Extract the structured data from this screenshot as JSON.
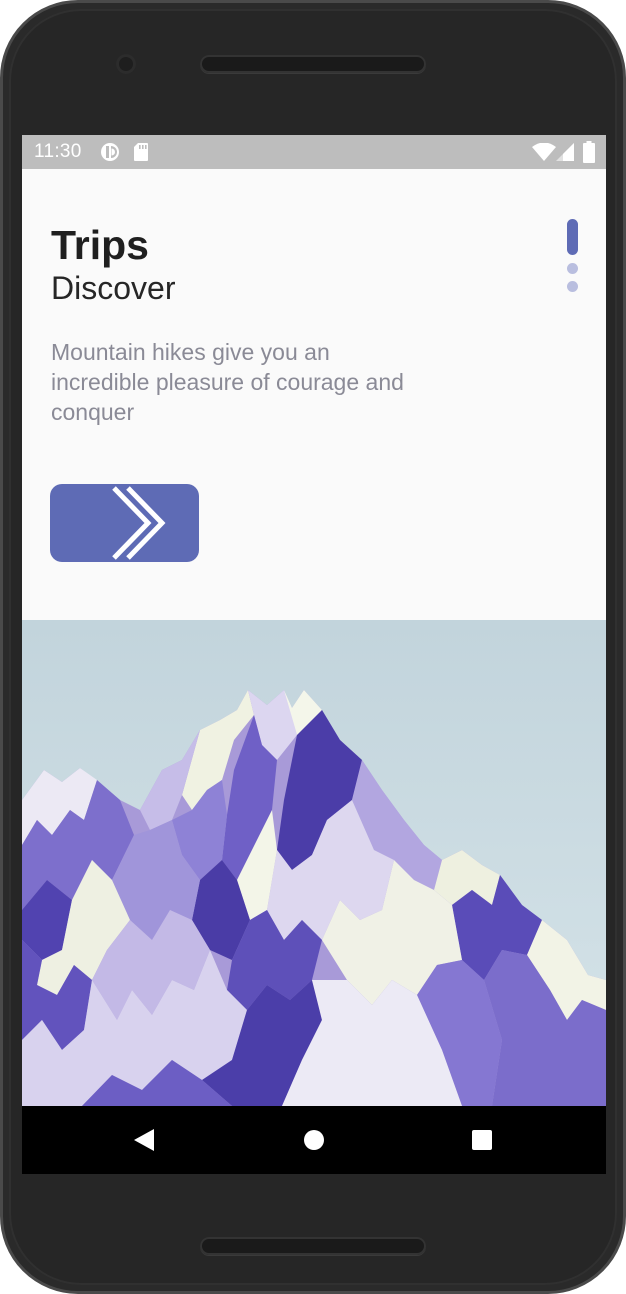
{
  "status_bar": {
    "time": "11:30",
    "icons": [
      "data-saver-icon",
      "sd-card-icon",
      "wifi-icon",
      "signal-icon",
      "battery-icon"
    ]
  },
  "onboarding": {
    "title": "Trips",
    "subtitle": "Discover",
    "description": "Mountain hikes give you an incredible pleasure of courage and conquer",
    "next_button_icon": "double-chevron-right-icon",
    "page_indicator": {
      "total_pages": 3,
      "current_page": 1
    }
  },
  "hero_image": {
    "subject": "mountain-illustration"
  },
  "navigation_bar": {
    "buttons": [
      "back-icon",
      "home-icon",
      "recents-icon"
    ]
  },
  "colors": {
    "accent": "#5e6bb5",
    "indicator_inactive": "#b9bedf",
    "status_bar": "#bdbdbd",
    "sky": "#c5d7df",
    "mountain_dark": "#5346b0",
    "mountain_light": "#b4a8e0",
    "snow": "#f2f4e6"
  }
}
